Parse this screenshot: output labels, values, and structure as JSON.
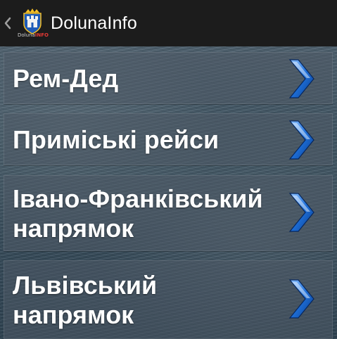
{
  "action_bar": {
    "title": "DolunaInfo",
    "logo_caption_plain": "Doluna",
    "logo_caption_accent": "INFO",
    "up_icon": "chevron-left-icon",
    "logo_icon": "coat-of-arms-icon"
  },
  "menu": {
    "items": [
      {
        "label": "Рем-Дед",
        "icon": "chevron-right-icon"
      },
      {
        "label": "Приміські рейси",
        "icon": "chevron-right-icon"
      },
      {
        "label": "Івано-Франківський напрямок",
        "icon": "chevron-right-icon"
      },
      {
        "label": "Львівський напрямок",
        "icon": "chevron-right-icon"
      }
    ]
  },
  "colors": {
    "action_bar_bg": "#1c1c1c",
    "chevron_blue": "#1565c0",
    "text": "#ffffff",
    "logo_accent": "#e53935"
  }
}
